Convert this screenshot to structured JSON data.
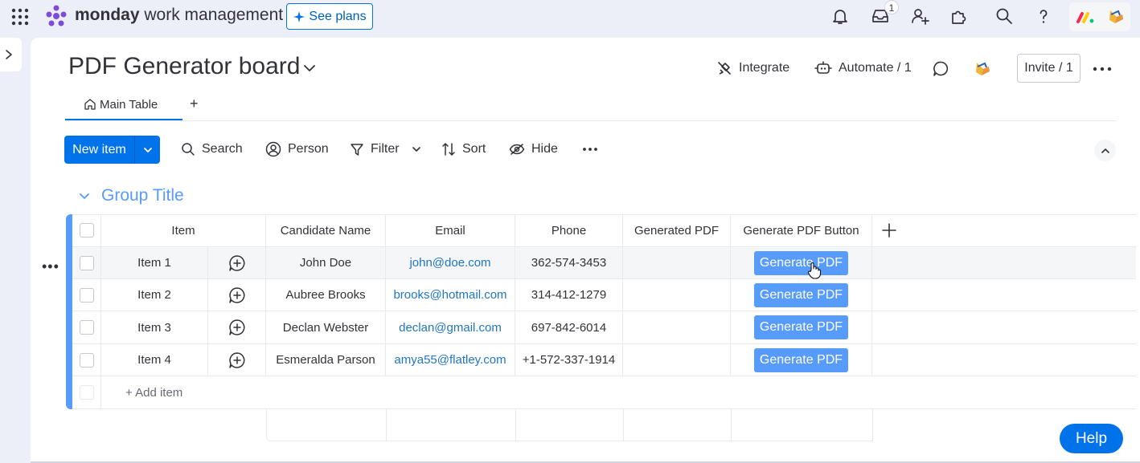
{
  "app": {
    "brand_bold": "monday",
    "brand_rest": "work management",
    "see_plans": "See plans",
    "inbox_badge": "1"
  },
  "board": {
    "title": "PDF Generator board",
    "integrate": "Integrate",
    "automate": "Automate / 1",
    "invite": "Invite / 1"
  },
  "tabs": [
    {
      "label": "Main Table"
    }
  ],
  "toolbar": {
    "new_item": "New item",
    "search": "Search",
    "person": "Person",
    "filter": "Filter",
    "sort": "Sort",
    "hide": "Hide"
  },
  "group": {
    "title": "Group Title",
    "add_item": "+ Add item"
  },
  "columns": [
    "Item",
    "Candidate Name",
    "Email",
    "Phone",
    "Generated PDF",
    "Generate PDF Button"
  ],
  "rows": [
    {
      "item": "Item 1",
      "name": "John Doe",
      "email": "john@doe.com",
      "phone": "362-574-3453",
      "generated": "",
      "button": "Generate PDF"
    },
    {
      "item": "Item 2",
      "name": "Aubree Brooks",
      "email": "brooks@hotmail.com",
      "phone": "314-412-1279",
      "generated": "",
      "button": "Generate PDF"
    },
    {
      "item": "Item 3",
      "name": "Declan Webster",
      "email": "declan@gmail.com",
      "phone": "697-842-6014",
      "generated": "",
      "button": "Generate PDF"
    },
    {
      "item": "Item 4",
      "name": "Esmeralda Parson",
      "email": "amya55@flatley.com",
      "phone": "+1-572-337-1914",
      "generated": "",
      "button": "Generate PDF"
    }
  ],
  "help": "Help",
  "colors": {
    "accent": "#0073ea",
    "group": "#579bfc",
    "email_link": "#1f76c2"
  }
}
